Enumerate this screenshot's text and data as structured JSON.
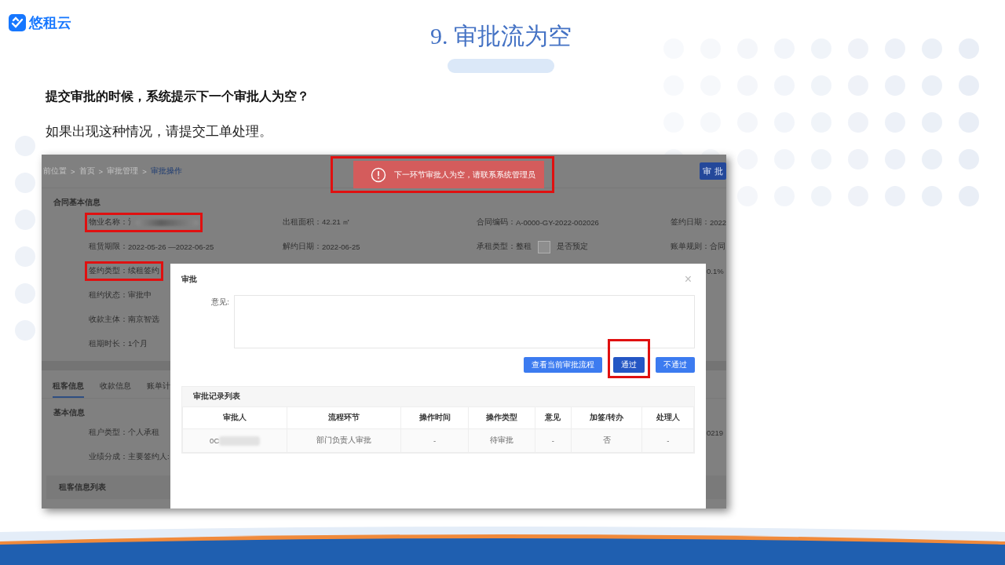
{
  "brand": {
    "name": "悠租云"
  },
  "slide": {
    "title": "9. 审批流为空",
    "question": "提交审批的时候，系统提示下一个审批人为空？",
    "answer": "如果出现这种情况，请提交工单处理。"
  },
  "app": {
    "breadcrumb": [
      {
        "label": "前位置",
        "selected": false
      },
      {
        "label": "首页",
        "selected": false
      },
      {
        "label": "审批管理",
        "selected": false
      },
      {
        "label": "审批操作",
        "selected": true
      }
    ],
    "breadcrumb_separator": ">",
    "action_button": "审 批",
    "toast": {
      "message": "下一环节审批人为空，请联系系统管理员",
      "annotated": true
    },
    "contract_section": "合同基本信息",
    "contract_rows": [
      [
        {
          "kind": "blurred",
          "label": "物业名称：",
          "value": "氵",
          "annotated": true
        },
        {
          "kind": "text",
          "label": "出租面积：",
          "value": "42.21 ㎡",
          "annotated": false
        },
        {
          "kind": "text",
          "label": "合同编码：",
          "value": "A-0000-GY-2022-002026",
          "annotated": false
        },
        {
          "kind": "text",
          "label": "签约日期：",
          "value": "2022",
          "annotated": false
        }
      ],
      [
        {
          "kind": "text",
          "label": "租赁期限：",
          "value": "2022-05-26 —2022-06-25",
          "annotated": false
        },
        {
          "kind": "text",
          "label": "解约日期：",
          "value": "2022-06-25",
          "annotated": false
        },
        {
          "kind": "checkbox",
          "label": "承租类型：",
          "value": "整租",
          "checked": false,
          "option": "是否预定",
          "annotated": false
        },
        {
          "kind": "text",
          "label": "账单规则：",
          "value": "合同",
          "annotated": false
        }
      ],
      [
        {
          "kind": "text",
          "label": "签约类型：",
          "value": "续租签约",
          "annotated": true
        },
        {
          "kind": "tail",
          "value": "0.1%"
        }
      ],
      [
        {
          "kind": "text",
          "label": "租约状态：",
          "value": "审批中",
          "annotated": false
        }
      ],
      [
        {
          "kind": "text",
          "label": "收款主体：",
          "value": "南京智选",
          "annotated": false
        }
      ],
      [
        {
          "kind": "text",
          "label": "租期时长：",
          "value": "1个月",
          "annotated": false
        }
      ]
    ],
    "tabs": [
      {
        "label": "租客信息",
        "selected": true
      },
      {
        "label": "收款信息",
        "selected": false
      },
      {
        "label": "账单计",
        "selected": false
      }
    ],
    "basic_section": "基本信息",
    "basic_rows": [
      [
        {
          "kind": "text",
          "label": "租户类型：",
          "value": "个人承租",
          "annotated": false
        },
        {
          "kind": "tail",
          "value": "0219"
        }
      ],
      [
        {
          "kind": "text",
          "label": "业绩分成：",
          "value": "主要签约人:",
          "annotated": false
        }
      ]
    ],
    "tenant_list_title": "租客信息列表"
  },
  "dialog": {
    "title": "审批",
    "close": "×",
    "comment_label": "意见:",
    "buttons": [
      {
        "label": "查看当前审批流程",
        "kind": "secondary",
        "annotated": false
      },
      {
        "label": "通过",
        "kind": "primary",
        "annotated": true
      },
      {
        "label": "不通过",
        "kind": "secondary",
        "annotated": false
      }
    ],
    "records": {
      "title": "审批记录列表",
      "columns": [
        "审批人",
        "流程环节",
        "操作时间",
        "操作类型",
        "意见",
        "加签/转办",
        "处理人"
      ],
      "rows": [
        [
          {
            "text": "0C",
            "blurred": true
          },
          {
            "text": "部门负责人审批",
            "blurred": false
          },
          {
            "text": "-",
            "blurred": false
          },
          {
            "text": "待审批",
            "blurred": false
          },
          {
            "text": "-",
            "blurred": false
          },
          {
            "text": "否",
            "blurred": false
          },
          {
            "text": "-",
            "blurred": false
          }
        ]
      ]
    }
  }
}
